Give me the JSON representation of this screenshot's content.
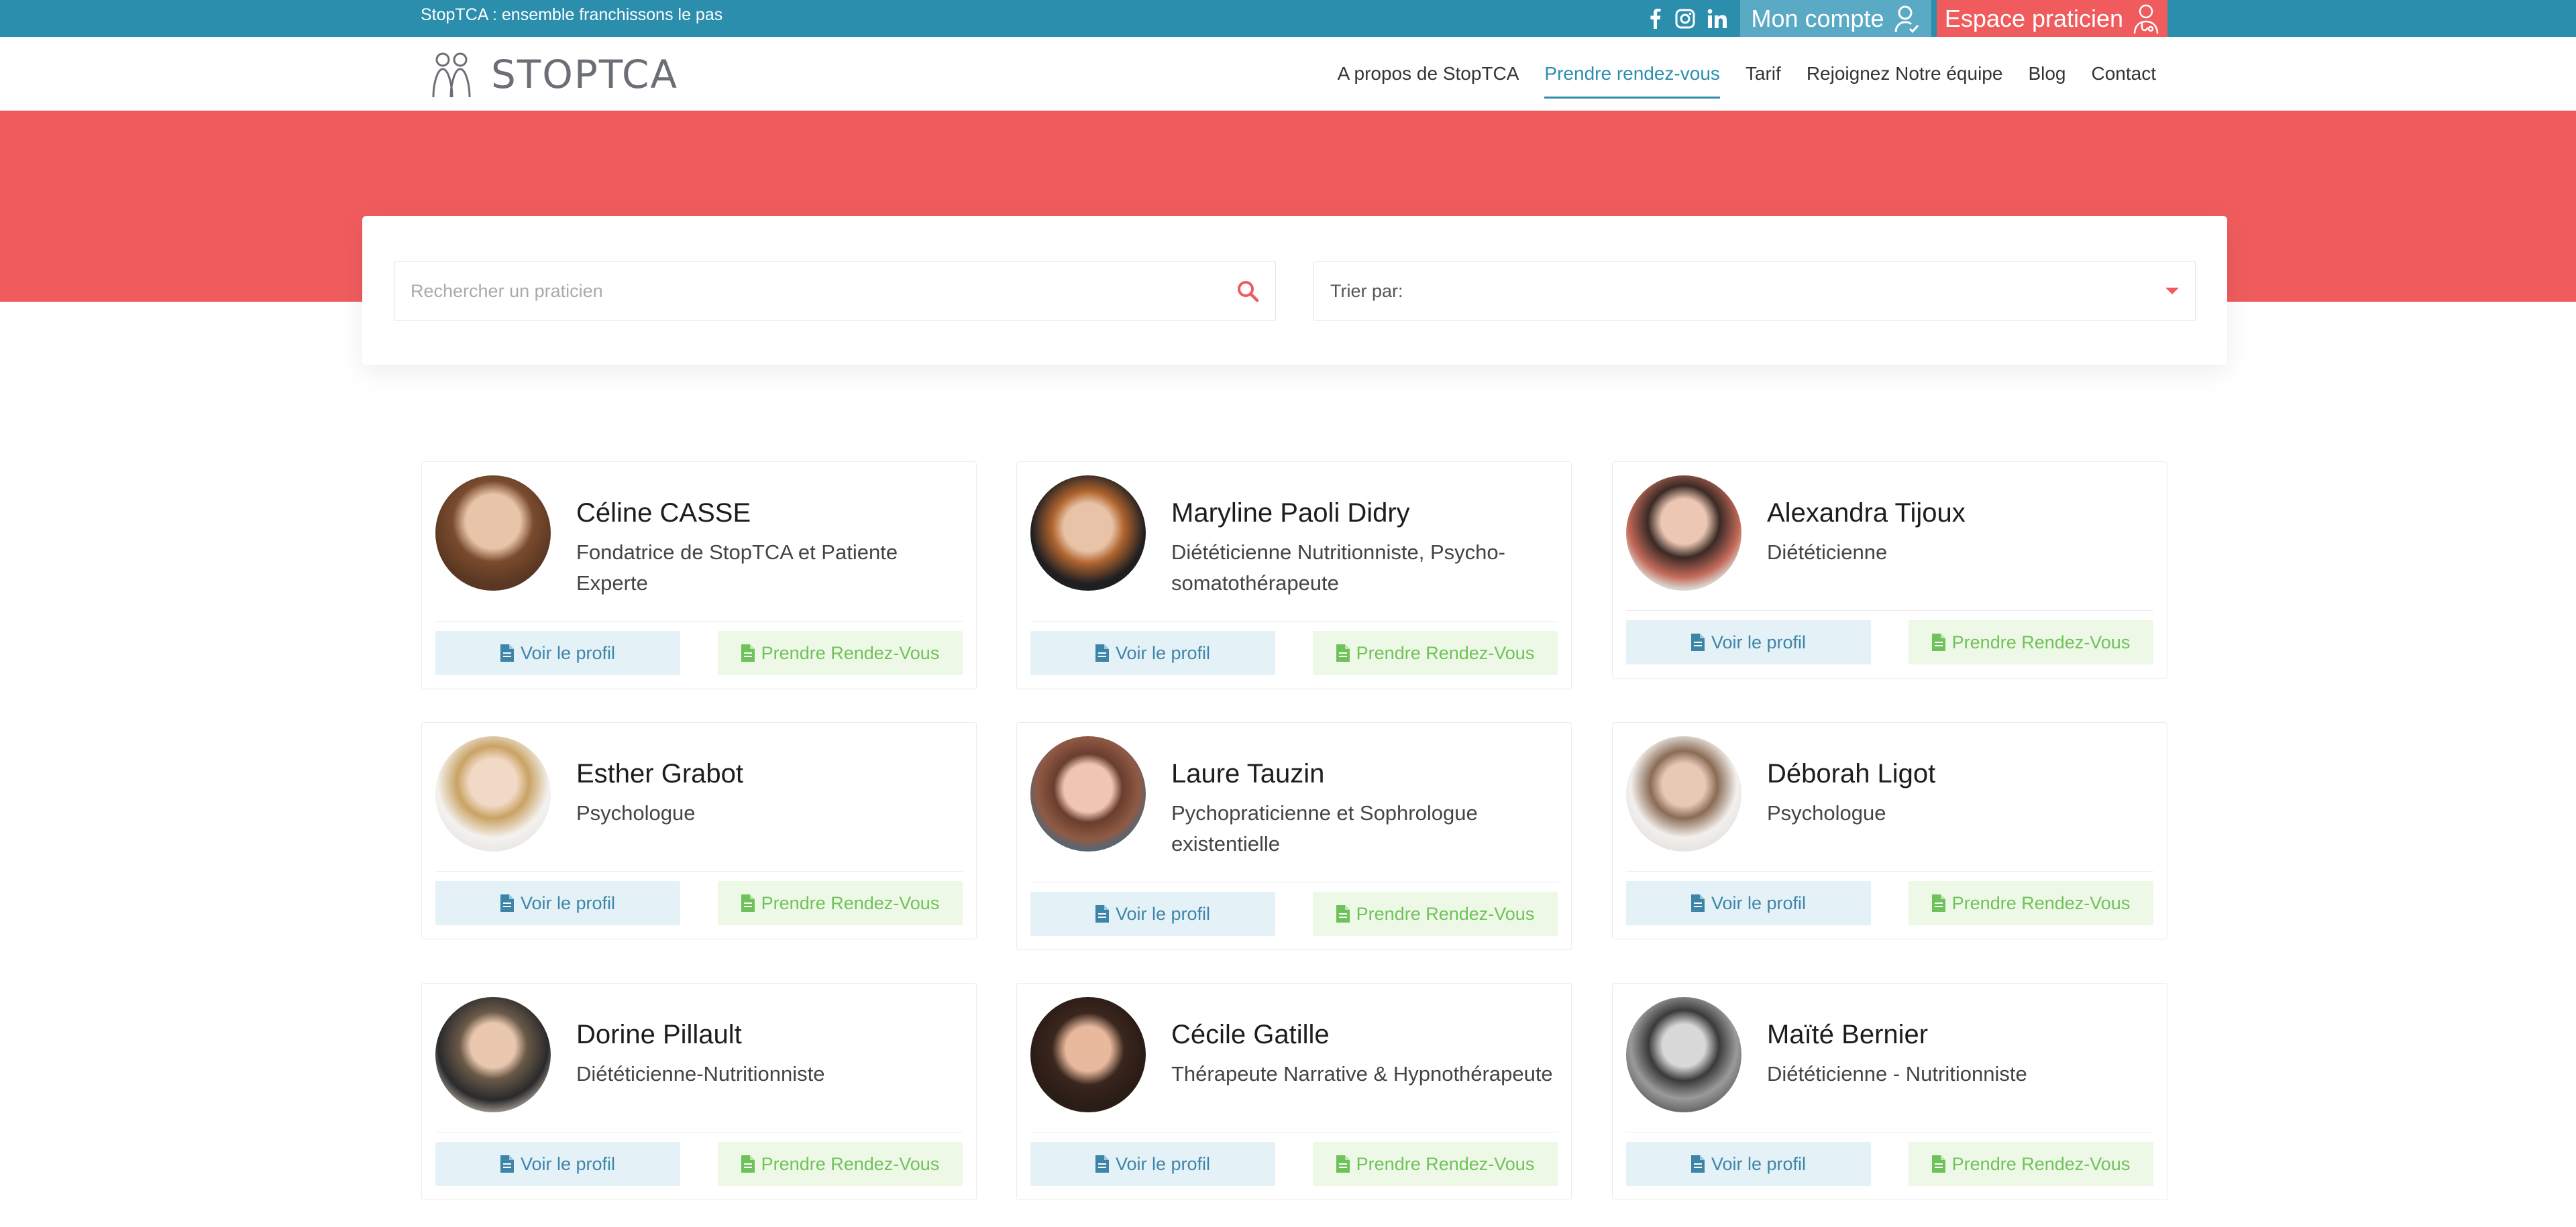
{
  "topbar": {
    "tagline": "StopTCA : ensemble franchissons le pas",
    "social": [
      "facebook-icon",
      "instagram-icon",
      "linkedin-icon"
    ],
    "account_label": "Mon compte",
    "pro_label": "Espace praticien"
  },
  "nav": {
    "logo_text": "STOPTCA",
    "items": [
      {
        "label": "A propos de StopTCA",
        "active": false
      },
      {
        "label": "Prendre rendez-vous",
        "active": true
      },
      {
        "label": "Tarif",
        "active": false
      },
      {
        "label": "Rejoignez Notre équipe",
        "active": false
      },
      {
        "label": "Blog",
        "active": false
      },
      {
        "label": "Contact",
        "active": false
      }
    ]
  },
  "search": {
    "placeholder": "Rechercher un praticien",
    "sort_label": "Trier par:"
  },
  "colors": {
    "primary": "#2b8ead",
    "accent": "#f05c5e",
    "account": "#5aa9c5",
    "profile_btn_bg": "#e4f1f7",
    "rdv_btn_bg": "#eef8e6",
    "rdv_text": "#6fc25a"
  },
  "practitioners": [
    {
      "name": "Céline CASSE",
      "title": "Fondatrice de StopTCA et Patiente Experte",
      "profile_label": "Voir le profil",
      "rdv_label": "Prendre Rendez-Vous"
    },
    {
      "name": "Maryline Paoli Didry",
      "title": "Diététicienne Nutritionniste, Psycho-somatothérapeute",
      "profile_label": "Voir le profil",
      "rdv_label": "Prendre Rendez-Vous"
    },
    {
      "name": "Alexandra Tijoux",
      "title": "Diététicienne",
      "profile_label": "Voir le profil",
      "rdv_label": "Prendre Rendez-Vous"
    },
    {
      "name": "Esther Grabot",
      "title": "Psychologue",
      "profile_label": "Voir le profil",
      "rdv_label": "Prendre Rendez-Vous"
    },
    {
      "name": "Laure Tauzin",
      "title": "Pychopraticienne et Sophrologue existentielle",
      "profile_label": "Voir le profil",
      "rdv_label": "Prendre Rendez-Vous"
    },
    {
      "name": "Déborah Ligot",
      "title": "Psychologue",
      "profile_label": "Voir le profil",
      "rdv_label": "Prendre Rendez-Vous"
    },
    {
      "name": "Dorine Pillault",
      "title": "Diététicienne-Nutritionniste",
      "profile_label": "Voir le profil",
      "rdv_label": "Prendre Rendez-Vous"
    },
    {
      "name": "Cécile Gatille",
      "title": "Thérapeute Narrative & Hypnothérapeute",
      "profile_label": "Voir le profil",
      "rdv_label": "Prendre Rendez-Vous"
    },
    {
      "name": "Maïté Bernier",
      "title": "Diététicienne - Nutritionniste",
      "profile_label": "Voir le profil",
      "rdv_label": "Prendre Rendez-Vous"
    }
  ]
}
